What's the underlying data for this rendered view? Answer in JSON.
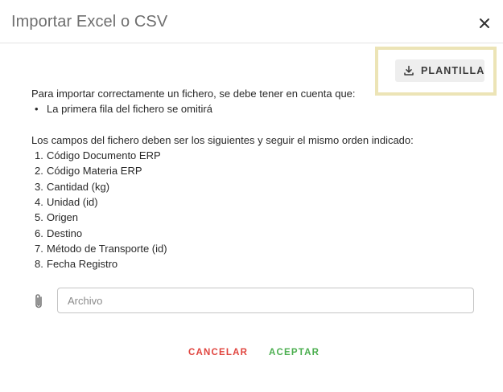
{
  "dialog": {
    "title": "Importar Excel o CSV",
    "template_button_label": "PLANTILLA",
    "intro": "Para importar correctamente un fichero, se debe tener en cuenta que:",
    "notes": [
      "La primera fila del fichero se omitirá"
    ],
    "fields_intro": "Los campos del fichero deben ser los siguientes y seguir el mismo orden indicado:",
    "fields": [
      "Código Documento ERP",
      "Código Materia ERP",
      "Cantidad (kg)",
      "Unidad (id)",
      "Origen",
      "Destino",
      "Método de Transporte (id)",
      "Fecha Registro"
    ],
    "file_input": {
      "placeholder": "Archivo",
      "value": ""
    },
    "cancel_label": "CANCELAR",
    "accept_label": "ACEPTAR"
  },
  "colors": {
    "cancel": "#e0443e",
    "accept": "#4caf50",
    "highlight_border": "#ece4b6",
    "template_button_bg": "#eeeeee"
  },
  "icons": {
    "close": "close-icon",
    "download": "download-icon",
    "attach": "paperclip-icon"
  }
}
